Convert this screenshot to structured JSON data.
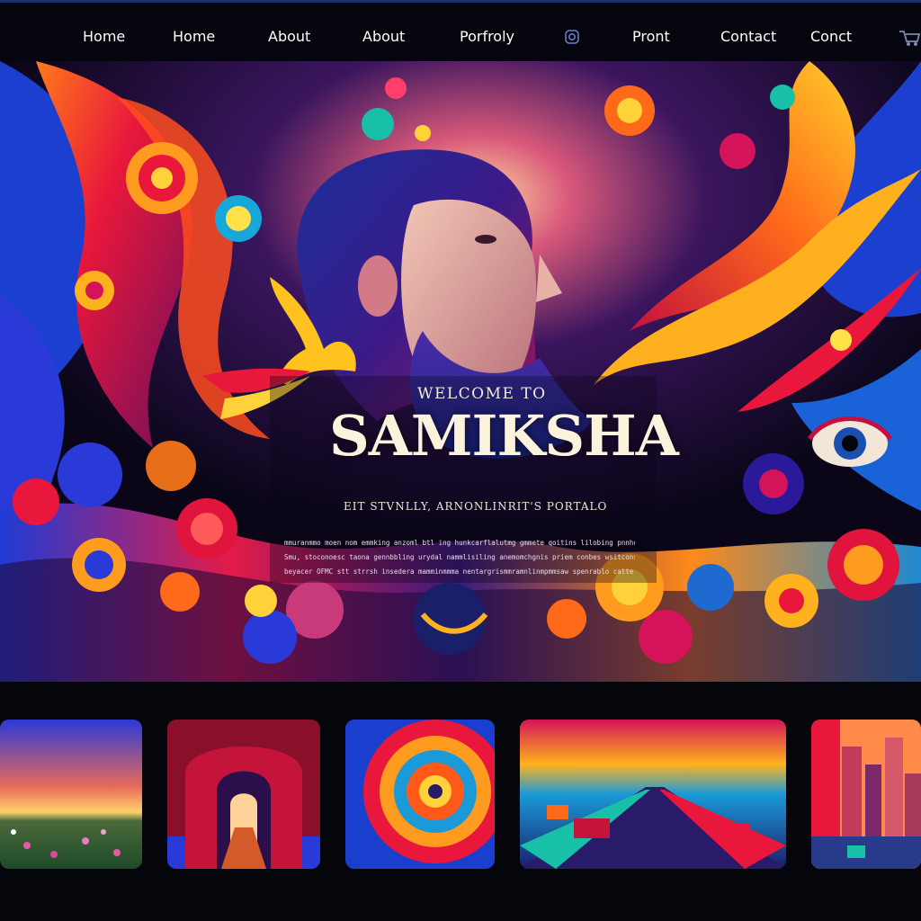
{
  "nav": {
    "items": [
      {
        "label": "Home"
      },
      {
        "label": "Home"
      },
      {
        "label": "About"
      },
      {
        "label": "About"
      },
      {
        "label": "Porfroly"
      },
      {
        "label": "Pront"
      },
      {
        "label": "Contact"
      },
      {
        "label": "Conct"
      }
    ],
    "icons": [
      "instagram-icon",
      "cart-icon"
    ]
  },
  "hero": {
    "welcome": "Welcome to",
    "title": "SAMIKSHA",
    "tagline": "Eit Stvnlly, Arnonlinrit's Portalo",
    "blurb": [
      "mmuranmmo moen nom emmking anzoml btl ing hunkcarflalutmg gmmete qoitins lilobing pnnhoracsmuning",
      "Smu, stoconoesc taona gennbbling urydal nammlisiling anemomchgnis priem conbes wsitconsbrmrr",
      "beyacer OFMC stt strrsh insedera mamminmmma nentargrismmramnlinmpmmsaw spenrablo catte hbn"
    ]
  },
  "gallery": {
    "items": [
      {
        "name": "sunset-meadow"
      },
      {
        "name": "red-archway"
      },
      {
        "name": "color-swirl"
      },
      {
        "name": "neon-highway"
      },
      {
        "name": "city-skyline"
      }
    ]
  },
  "colors": {
    "background": "#05060c",
    "nav_text": "#ffffff",
    "headline": "#fbf3dc"
  }
}
